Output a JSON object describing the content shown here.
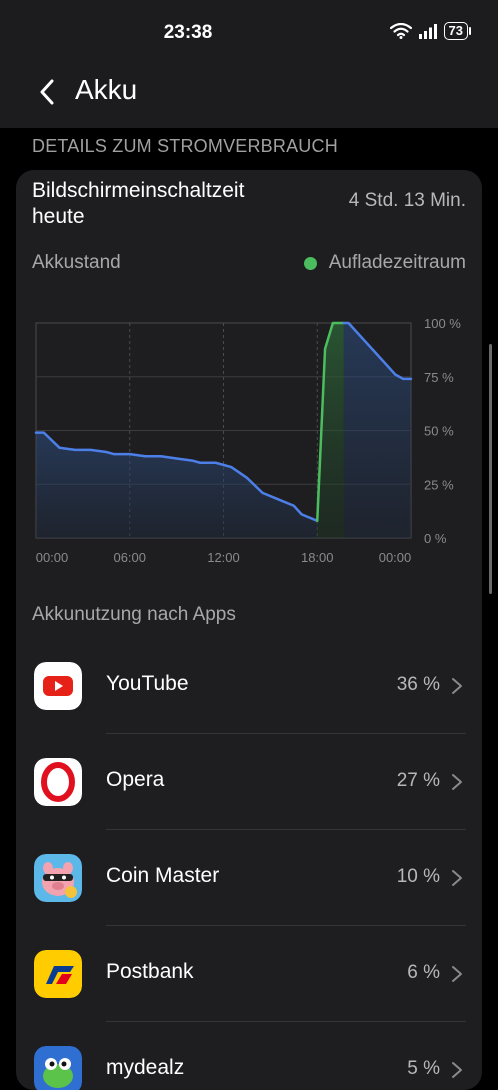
{
  "status_bar": {
    "time": "23:38",
    "battery": "73"
  },
  "header": {
    "title": "Akku"
  },
  "section_header": "DETAILS ZUM STROMVERBRAUCH",
  "screen_time": {
    "label": "Bildschirmeinschaltzeit heute",
    "value": "4 Std. 13 Min."
  },
  "chart_data": {
    "type": "area",
    "title": "Akkustand",
    "legend": [
      {
        "name": "Aufladezeitraum",
        "color": "#4cbd5f"
      }
    ],
    "x_tick_labels": [
      "00:00",
      "06:00",
      "12:00",
      "18:00",
      "00:00"
    ],
    "y_tick_labels": [
      "100 %",
      "75 %",
      "50 %",
      "25 %",
      "0 %"
    ],
    "xlim_hours": [
      0,
      24
    ],
    "ylim": [
      0,
      100
    ],
    "grid": true,
    "series": [
      {
        "color": "#4d7fe8",
        "x_hours": [
          0,
          0.5,
          1.5,
          2.5,
          3.5,
          4.5,
          5,
          6,
          7,
          8,
          9,
          10,
          10.5,
          11.5,
          12.5,
          13.5,
          14.5,
          15.5,
          16.5,
          17,
          18
        ],
        "y": [
          49,
          49,
          42,
          41,
          41,
          40,
          39,
          39,
          38,
          38,
          37,
          36,
          35,
          35,
          33,
          28,
          21,
          18,
          15,
          11,
          8
        ]
      },
      {
        "name": "Aufladezeitraum",
        "color": "#4cbd5f",
        "x_hours": [
          18,
          18.5,
          19,
          19.7
        ],
        "y": [
          8,
          88,
          100,
          100
        ]
      },
      {
        "color": "#4d7fe8",
        "x_hours": [
          19.7,
          20,
          21,
          22,
          23,
          23.5,
          24
        ],
        "y": [
          100,
          100,
          92,
          84,
          76,
          74,
          74
        ]
      }
    ]
  },
  "apps_section": {
    "title": "Akkunutzung nach Apps"
  },
  "apps": [
    {
      "name": "YouTube",
      "percent": "36 %",
      "icon": "youtube-icon"
    },
    {
      "name": "Opera",
      "percent": "27 %",
      "icon": "opera-icon"
    },
    {
      "name": "Coin Master",
      "percent": "10 %",
      "icon": "coin-master-icon"
    },
    {
      "name": "Postbank",
      "percent": "6 %",
      "icon": "postbank-icon"
    },
    {
      "name": "mydealz",
      "percent": "5 %",
      "icon": "mydealz-icon"
    }
  ]
}
